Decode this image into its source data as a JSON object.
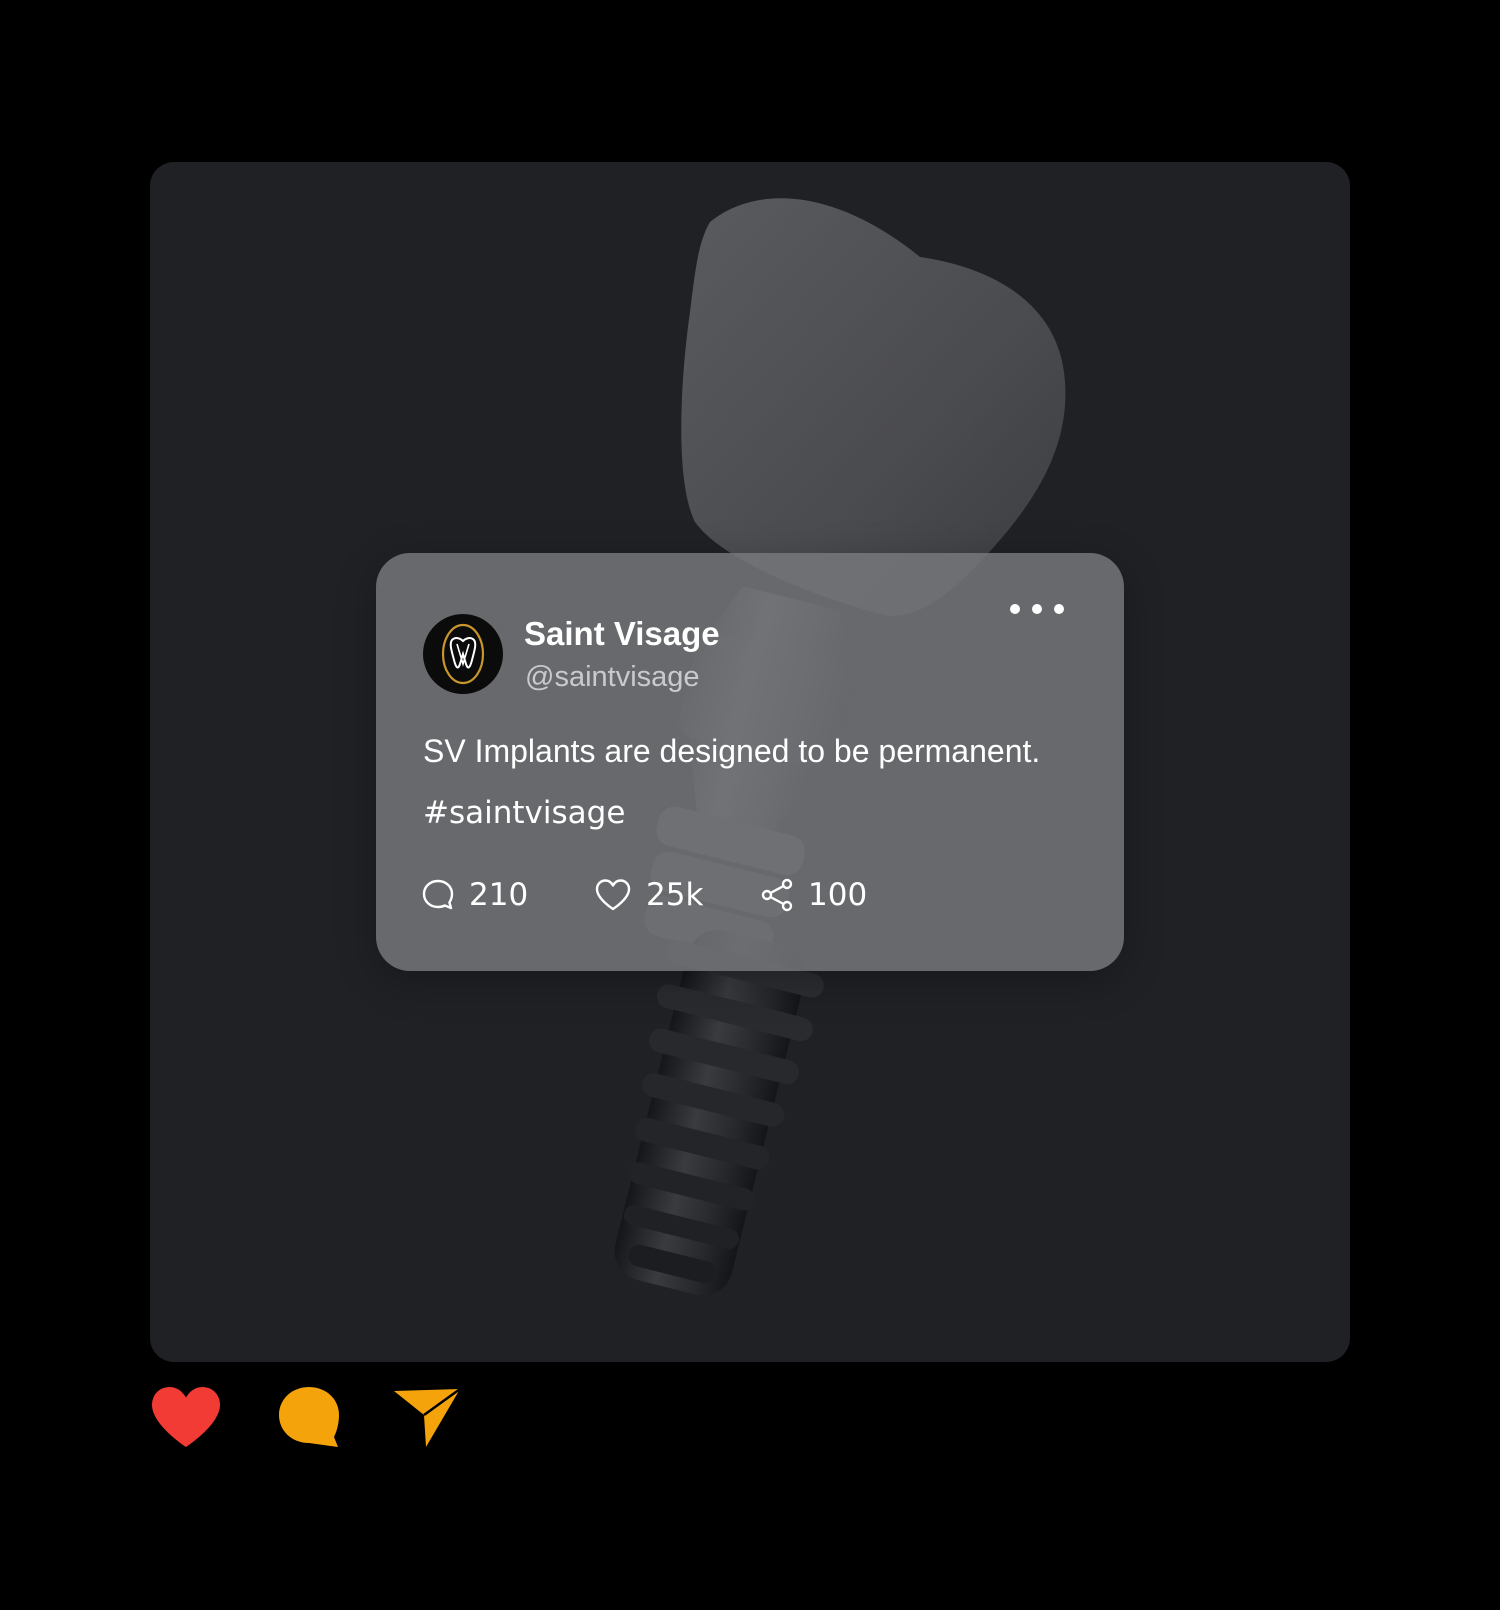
{
  "post": {
    "illustration": "dental-implant-render"
  },
  "tweet": {
    "display_name": "Saint Visage",
    "handle": "@saintvisage",
    "text": "SV Implants are designed to be permanent.",
    "hashtag": "#saintvisage",
    "avatar_icon": "saint-visage-tooth-logo",
    "more_icon": "more-dots-icon",
    "stats": {
      "replies": {
        "icon": "comment-outline-icon",
        "count": "210"
      },
      "likes": {
        "icon": "heart-outline-icon",
        "count": "25k"
      },
      "shares": {
        "icon": "share-icon",
        "count": "100"
      }
    }
  },
  "actions": {
    "like": {
      "icon": "heart-filled-icon",
      "color": "#f13b34"
    },
    "comment": {
      "icon": "comment-bubble-icon",
      "color": "#f4a40a"
    },
    "send": {
      "icon": "send-arrow-icon",
      "color": "#f4a40a"
    }
  },
  "colors": {
    "background": "#000000",
    "frame": "#202125",
    "card": "#78797d",
    "logo_gold": "#c8962a"
  }
}
